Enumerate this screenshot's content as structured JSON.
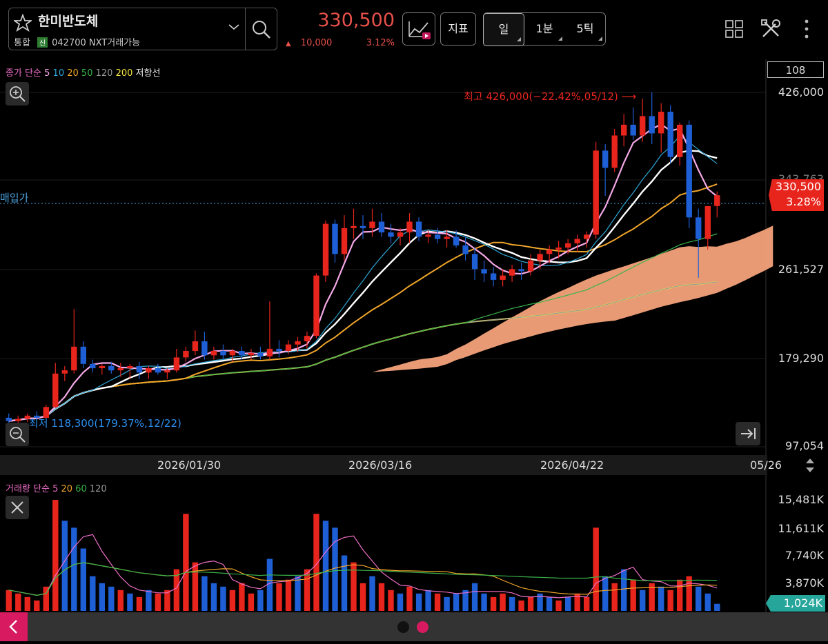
{
  "header": {
    "stock_name": "한미반도체",
    "market_label": "통합",
    "credit_badge": "신",
    "stock_code": "042700",
    "trade_note": "NXT거래가능",
    "price": "330,500",
    "change_arrow": "▲",
    "change_amount": "10,000",
    "change_pct": "3.12%",
    "indicator_label": "지표",
    "timeframes": [
      "일",
      "1분",
      "5틱"
    ],
    "icons": [
      "star-icon",
      "chevron-down-icon",
      "search-icon",
      "chart-play-icon",
      "grid-icon",
      "tools-icon",
      "more-vert-icon"
    ]
  },
  "price_panel": {
    "legend": {
      "main": "종가 단순",
      "ma5": "5",
      "ma10": "10",
      "ma20": "20",
      "ma50": "50",
      "ma120": "120",
      "ma200": "200",
      "resist": "저항선"
    },
    "count_box": "108",
    "axis_labels": [
      "426,000",
      "343,763",
      "261,527",
      "179,290",
      "97,054"
    ],
    "high_annotation": "최고 426,000(−22.42%,05/12) ⟶",
    "low_annotation": "최저 118,300(179.37%,12/22)",
    "buy_price_label": "매입가",
    "current_price_tag": "330,500",
    "current_pct_tag": "3.28%",
    "dates": [
      "2026/01/30",
      "2026/03/16",
      "2026/04/22",
      "05/26"
    ]
  },
  "volume_panel": {
    "legend": {
      "main": "거래량 단순",
      "ma5": "5",
      "ma20": "20",
      "ma60": "60",
      "ma120": "120"
    },
    "axis_labels": [
      "15,481K",
      "11,611K",
      "7,740K",
      "3,870K"
    ],
    "current_tag": "1,024K"
  },
  "colors": {
    "up": "#e8251d",
    "down": "#1e5fd6",
    "ma5": "#f5a9e8",
    "ma10": "#2fa8d8",
    "ma20": "#f0a52a",
    "ma50": "#3ab54a",
    "ma120": "#9a9a9a",
    "ma200": "#f5e642",
    "cloud": "#f4a27a",
    "cloud_blue": "#2b8ff0"
  },
  "chart_data": {
    "type": "candlestick",
    "ylim": [
      97054,
      426000
    ],
    "candles": [
      [
        124000,
        128000,
        118300,
        121000
      ],
      [
        121000,
        126000,
        119000,
        123000
      ],
      [
        123000,
        128000,
        120000,
        126000
      ],
      [
        126000,
        130000,
        122000,
        124000
      ],
      [
        124000,
        136000,
        123000,
        134000
      ],
      [
        134000,
        175000,
        133000,
        165000
      ],
      [
        165000,
        172000,
        158000,
        168000
      ],
      [
        168000,
        225000,
        165000,
        190000
      ],
      [
        190000,
        195000,
        170000,
        174000
      ],
      [
        174000,
        178000,
        166000,
        170000
      ],
      [
        170000,
        174000,
        164000,
        172000
      ],
      [
        172000,
        176000,
        165000,
        168000
      ],
      [
        168000,
        175000,
        162000,
        170000
      ],
      [
        170000,
        174000,
        160000,
        172000
      ],
      [
        172000,
        176000,
        160000,
        166000
      ],
      [
        166000,
        172000,
        160000,
        170000
      ],
      [
        170000,
        174000,
        164000,
        166000
      ],
      [
        166000,
        170000,
        160000,
        168000
      ],
      [
        168000,
        188000,
        166000,
        180000
      ],
      [
        180000,
        190000,
        176000,
        186000
      ],
      [
        186000,
        205000,
        182000,
        195000
      ],
      [
        195000,
        204000,
        178000,
        182000
      ],
      [
        182000,
        190000,
        178000,
        186000
      ],
      [
        186000,
        192000,
        178000,
        182000
      ],
      [
        182000,
        188000,
        176000,
        186000
      ],
      [
        186000,
        190000,
        178000,
        182000
      ],
      [
        182000,
        188000,
        178000,
        184000
      ],
      [
        184000,
        190000,
        178000,
        181000
      ],
      [
        181000,
        232000,
        178000,
        188000
      ],
      [
        188000,
        196000,
        180000,
        186000
      ],
      [
        186000,
        196000,
        183000,
        192000
      ],
      [
        192000,
        199000,
        185000,
        195000
      ],
      [
        195000,
        204000,
        188000,
        200000
      ],
      [
        200000,
        258000,
        198000,
        256000
      ],
      [
        256000,
        307000,
        250000,
        304000
      ],
      [
        304000,
        308000,
        268000,
        276000
      ],
      [
        276000,
        312000,
        270000,
        300000
      ],
      [
        300000,
        318000,
        290000,
        302000
      ],
      [
        302000,
        312000,
        290000,
        300000
      ],
      [
        300000,
        318000,
        292000,
        306000
      ],
      [
        306000,
        314000,
        292000,
        296000
      ],
      [
        296000,
        304000,
        286000,
        292000
      ],
      [
        292000,
        300000,
        284000,
        296000
      ],
      [
        296000,
        314000,
        286000,
        306000
      ],
      [
        306000,
        310000,
        288000,
        292000
      ],
      [
        292000,
        298000,
        286000,
        294000
      ],
      [
        294000,
        300000,
        286000,
        290000
      ],
      [
        290000,
        298000,
        282000,
        292000
      ],
      [
        292000,
        298000,
        282000,
        284000
      ],
      [
        284000,
        292000,
        270000,
        276000
      ],
      [
        276000,
        282000,
        252000,
        262000
      ],
      [
        262000,
        270000,
        250000,
        258000
      ],
      [
        258000,
        264000,
        246000,
        252000
      ],
      [
        252000,
        262000,
        246000,
        256000
      ],
      [
        256000,
        266000,
        250000,
        262000
      ],
      [
        262000,
        268000,
        252000,
        260000
      ],
      [
        260000,
        276000,
        256000,
        270000
      ],
      [
        270000,
        280000,
        262000,
        276000
      ],
      [
        276000,
        284000,
        268000,
        280000
      ],
      [
        280000,
        288000,
        272000,
        282000
      ],
      [
        282000,
        290000,
        276000,
        286000
      ],
      [
        286000,
        294000,
        278000,
        290000
      ],
      [
        290000,
        297000,
        282000,
        294000
      ],
      [
        294000,
        380000,
        290000,
        372000
      ],
      [
        372000,
        378000,
        330000,
        356000
      ],
      [
        356000,
        392000,
        352000,
        386000
      ],
      [
        386000,
        406000,
        376000,
        396000
      ],
      [
        396000,
        412000,
        382000,
        386000
      ],
      [
        386000,
        420000,
        380000,
        404000
      ],
      [
        404000,
        426000,
        378000,
        388000
      ],
      [
        388000,
        416000,
        370000,
        408000
      ],
      [
        408000,
        414000,
        360000,
        366000
      ],
      [
        366000,
        398000,
        358000,
        396000
      ],
      [
        396000,
        400000,
        300000,
        310000
      ],
      [
        310000,
        318000,
        254000,
        290000
      ],
      [
        290000,
        312000,
        280000,
        320500
      ],
      [
        320500,
        334000,
        310000,
        330500
      ]
    ],
    "volume": [
      [
        3000,
        1
      ],
      [
        2500,
        1
      ],
      [
        2000,
        1
      ],
      [
        1500,
        1
      ],
      [
        3500,
        1
      ],
      [
        16000,
        1
      ],
      [
        13000,
        0
      ],
      [
        12000,
        0
      ],
      [
        9000,
        0
      ],
      [
        5000,
        0
      ],
      [
        4000,
        0
      ],
      [
        3500,
        0
      ],
      [
        3000,
        1
      ],
      [
        2500,
        0
      ],
      [
        2000,
        1
      ],
      [
        3000,
        0
      ],
      [
        2500,
        1
      ],
      [
        3000,
        1
      ],
      [
        6000,
        1
      ],
      [
        14000,
        1
      ],
      [
        7000,
        1
      ],
      [
        5000,
        0
      ],
      [
        4000,
        0
      ],
      [
        3500,
        0
      ],
      [
        3000,
        1
      ],
      [
        4000,
        1
      ],
      [
        2500,
        1
      ],
      [
        3000,
        0
      ],
      [
        7500,
        0
      ],
      [
        4000,
        1
      ],
      [
        4500,
        1
      ],
      [
        5000,
        0
      ],
      [
        6000,
        1
      ],
      [
        14000,
        1
      ],
      [
        13000,
        0
      ],
      [
        12000,
        0
      ],
      [
        8000,
        0
      ],
      [
        7000,
        1
      ],
      [
        4000,
        1
      ],
      [
        5000,
        0
      ],
      [
        4000,
        1
      ],
      [
        3000,
        1
      ],
      [
        2500,
        0
      ],
      [
        3500,
        1
      ],
      [
        2500,
        0
      ],
      [
        3000,
        0
      ],
      [
        2500,
        1
      ],
      [
        2000,
        0
      ],
      [
        2500,
        0
      ],
      [
        3000,
        0
      ],
      [
        4000,
        0
      ],
      [
        2500,
        0
      ],
      [
        2000,
        1
      ],
      [
        2500,
        1
      ],
      [
        2000,
        0
      ],
      [
        1500,
        1
      ],
      [
        2000,
        1
      ],
      [
        2500,
        0
      ],
      [
        2000,
        0
      ],
      [
        1500,
        1
      ],
      [
        2000,
        0
      ],
      [
        2500,
        1
      ],
      [
        2000,
        1
      ],
      [
        12000,
        1
      ],
      [
        5000,
        0
      ],
      [
        4000,
        1
      ],
      [
        6000,
        0
      ],
      [
        4500,
        1
      ],
      [
        3000,
        0
      ],
      [
        4000,
        1
      ],
      [
        3500,
        0
      ],
      [
        3000,
        1
      ],
      [
        4500,
        1
      ],
      [
        5000,
        1
      ],
      [
        3500,
        0
      ],
      [
        2500,
        0
      ],
      [
        1024,
        0
      ]
    ]
  }
}
